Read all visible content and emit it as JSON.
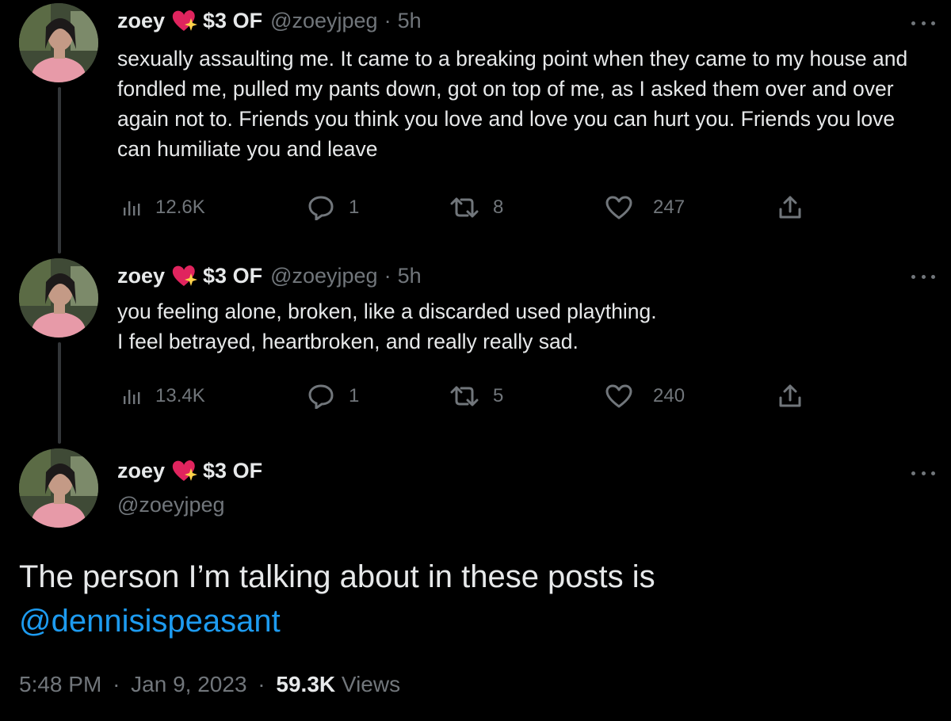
{
  "author": {
    "display_name": "zoey",
    "name_suffix": "$3 OF",
    "handle": "@zoeyjpeg",
    "badge_icon": "sparkling-heart-icon"
  },
  "separator": "·",
  "tweets": [
    {
      "time": "5h",
      "text": "sexually assaulting me. It came to a breaking point when they came to my house and fondled me, pulled my pants down, got on top of me, as I asked them over and over again not to. Friends you think you love and love you can hurt you. Friends you love can humiliate you and leave",
      "views": "12.6K",
      "replies": "1",
      "retweets": "8",
      "likes": "247"
    },
    {
      "time": "5h",
      "text_line1": "you feeling alone, broken, like a discarded used plaything.",
      "text_line2": "I feel betrayed, heartbroken, and really really sad.",
      "views": "13.4K",
      "replies": "1",
      "retweets": "5",
      "likes": "240"
    }
  ],
  "main_tweet": {
    "text": "The person I’m talking about in these posts is",
    "mention": "@dennisispeasant",
    "time": "5:48 PM",
    "date": "Jan 9, 2023",
    "views_count": "59.3K",
    "views_label": "Views"
  },
  "colors": {
    "background": "#000000",
    "text": "#e7e9ea",
    "muted": "#71767b",
    "link": "#1d9bf0",
    "thread_line": "#333639"
  }
}
